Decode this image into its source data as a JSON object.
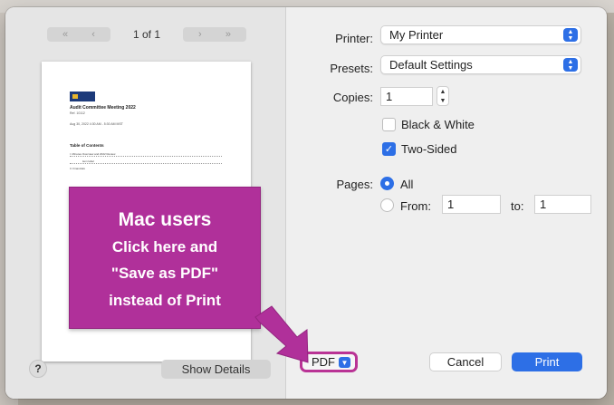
{
  "nav": {
    "first_glyph": "«",
    "prev_glyph": "‹",
    "next_glyph": "›",
    "last_glyph": "»",
    "page_indicator": "1 of 1"
  },
  "preview": {
    "doc_title": "Audit Committee Meeting 2022",
    "doc_subtitle": "Ref. 10112",
    "doc_date": "Aug 30, 2022 4:30 AM - 5:30 AM MST",
    "toc_heading": "Table of Contents",
    "toc_lines": [
      "I. Minutes Overview and 2022 Review",
      "item label",
      "II. Financials"
    ]
  },
  "form": {
    "printer_label": "Printer:",
    "printer_value": "My Printer",
    "presets_label": "Presets:",
    "presets_value": "Default Settings",
    "copies_label": "Copies:",
    "copies_value": "1",
    "bw_label": "Black & White",
    "bw_checked": false,
    "two_sided_label": "Two-Sided",
    "two_sided_checked": true,
    "pages_label": "Pages:",
    "all_label": "All",
    "from_label": "From:",
    "from_value": "1",
    "to_label": "to:",
    "to_value": "1"
  },
  "buttons": {
    "help": "?",
    "show_details": "Show Details",
    "pdf": "PDF",
    "cancel": "Cancel",
    "print": "Print"
  },
  "callout": {
    "title": "Mac users",
    "line1": "Click here and",
    "line2": "\"Save as PDF\"",
    "line3": "instead of Print",
    "color": "#b0309a"
  },
  "colors": {
    "accent": "#2d6fe6",
    "highlight": "#b93395"
  }
}
